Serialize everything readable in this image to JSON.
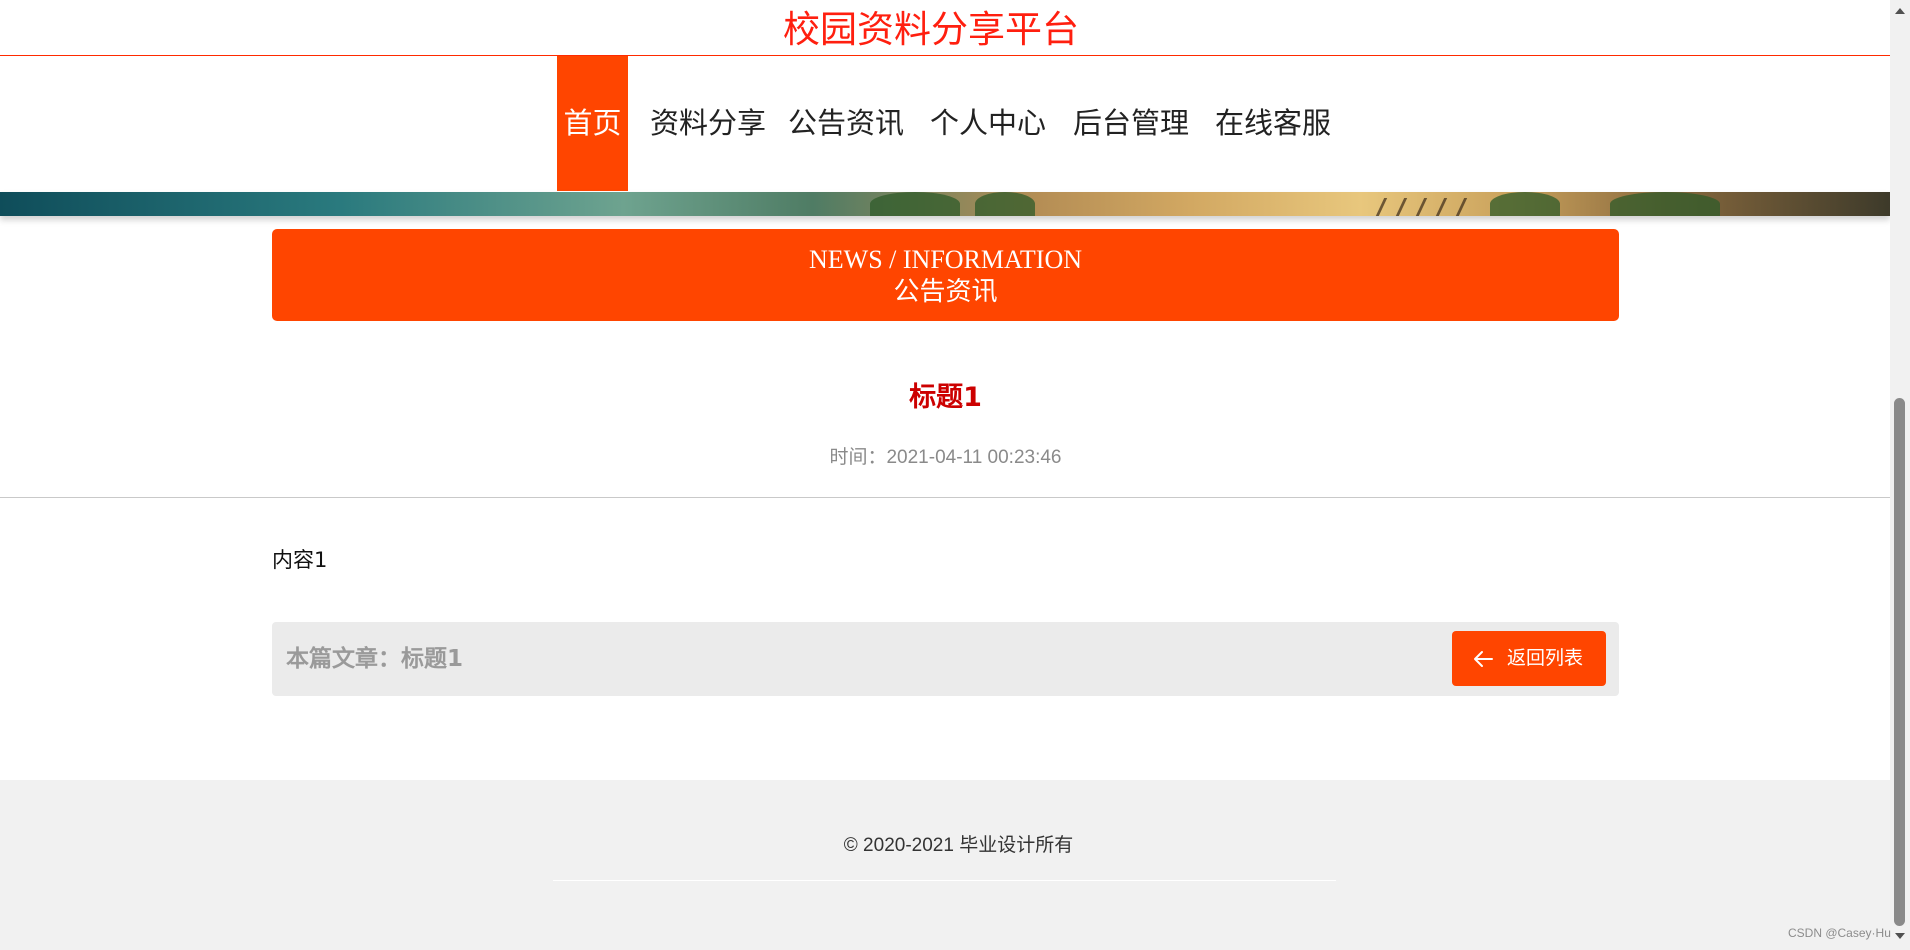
{
  "header": {
    "site_title": "校园资料分享平台"
  },
  "nav": {
    "items": [
      {
        "label": "首页",
        "active": true
      },
      {
        "label": "资料分享",
        "active": false
      },
      {
        "label": "公告资讯",
        "active": false
      },
      {
        "label": "个人中心",
        "active": false
      },
      {
        "label": "后台管理",
        "active": false
      },
      {
        "label": "在线客服",
        "active": false
      }
    ]
  },
  "section": {
    "title_en": "NEWS / INFORMATION",
    "title_cn": "公告资讯"
  },
  "article": {
    "title": "标题1",
    "time_label": "时间：",
    "time_value": "2021-04-11 00:23:46",
    "content": "内容1",
    "current_label": "本篇文章：",
    "current_title": "标题1",
    "back_button_label": "返回列表"
  },
  "footer": {
    "copyright_symbol": "© 2020-2021",
    "copyright_text": "毕业设计所有"
  },
  "watermark": "CSDN @Casey·Hu",
  "colors": {
    "accent": "#ff4500",
    "title_red": "#ff1f0f",
    "article_title_red": "#cc0000",
    "footer_bg": "#f1f1f1"
  },
  "icons": {
    "back_button": "arrow-left-icon"
  }
}
